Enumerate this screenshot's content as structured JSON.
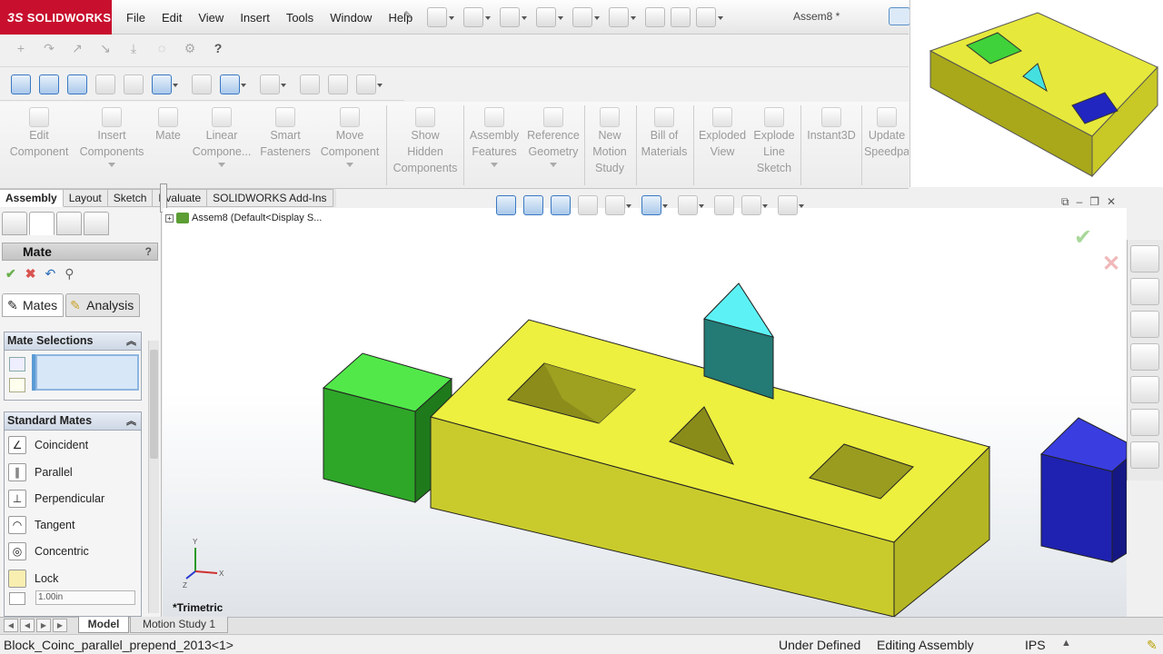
{
  "app": {
    "logo_prefix": "3S",
    "logo": "SOLIDWORKS",
    "doc_title": "Assem8 *"
  },
  "menu": [
    "File",
    "Edit",
    "View",
    "Insert",
    "Tools",
    "Window",
    "Help"
  ],
  "command_manager": [
    {
      "label1": "Edit",
      "label2": "Component",
      "icon": "edit-component-icon"
    },
    {
      "label1": "Insert",
      "label2": "Components",
      "icon": "insert-components-icon",
      "caret": true
    },
    {
      "label1": "Mate",
      "label2": "",
      "icon": "mate-icon"
    },
    {
      "label1": "Linear",
      "label2": "Compone...",
      "icon": "linear-pattern-icon",
      "caret": true
    },
    {
      "label1": "Smart",
      "label2": "Fasteners",
      "icon": "smart-fasteners-icon"
    },
    {
      "label1": "Move",
      "label2": "Component",
      "icon": "move-component-icon",
      "caret": true
    },
    {
      "label1": "Show",
      "label2": "Hidden",
      "label3": "Components",
      "icon": "show-hidden-icon"
    },
    {
      "label1": "Assembly",
      "label2": "Features",
      "icon": "assembly-features-icon",
      "caret": true
    },
    {
      "label1": "Reference",
      "label2": "Geometry",
      "icon": "reference-geometry-icon",
      "caret": true
    },
    {
      "label1": "New",
      "label2": "Motion",
      "label3": "Study",
      "icon": "new-motion-study-icon"
    },
    {
      "label1": "Bill of",
      "label2": "Materials",
      "icon": "bill-of-materials-icon"
    },
    {
      "label1": "Exploded",
      "label2": "View",
      "icon": "exploded-view-icon"
    },
    {
      "label1": "Explode",
      "label2": "Line",
      "label3": "Sketch",
      "icon": "explode-line-sketch-icon"
    },
    {
      "label1": "Instant3D",
      "label2": "",
      "icon": "instant3d-icon"
    },
    {
      "label1": "Update",
      "label2": "Speedpa",
      "icon": "update-speedpak-icon"
    }
  ],
  "tabs": [
    "Assembly",
    "Layout",
    "Sketch",
    "Evaluate",
    "SOLIDWORKS Add-Ins"
  ],
  "property_manager": {
    "title": "Mate",
    "subtabs": [
      "Mates",
      "Analysis"
    ],
    "selections_header": "Mate Selections",
    "standard_header": "Standard Mates",
    "mates": [
      {
        "label": "Coincident",
        "icon": "coincident-icon",
        "glyph": "∠"
      },
      {
        "label": "Parallel",
        "icon": "parallel-icon",
        "glyph": "∥"
      },
      {
        "label": "Perpendicular",
        "icon": "perpendicular-icon",
        "glyph": "⊥"
      },
      {
        "label": "Tangent",
        "icon": "tangent-icon",
        "glyph": "◠"
      },
      {
        "label": "Concentric",
        "icon": "concentric-icon",
        "glyph": "◎"
      },
      {
        "label": "Lock",
        "icon": "lock-icon",
        "glyph": "🔒"
      }
    ],
    "distance_value": "1.00in"
  },
  "tree": {
    "label": "Assem8  (Default<Display S..."
  },
  "view": {
    "orientation": "*Trimetric"
  },
  "bottom_tabs": [
    "Model",
    "Motion Study 1"
  ],
  "status": {
    "file": "Block_Coinc_parallel_prepend_2013<1>",
    "state": "Under Defined",
    "mode": "Editing Assembly",
    "units": "IPS"
  },
  "colors": {
    "brand": "#c8102e",
    "yellow": "#e8ea3a",
    "green": "#3fd23a",
    "teal": "#2a7a78",
    "blue": "#2326b8"
  }
}
